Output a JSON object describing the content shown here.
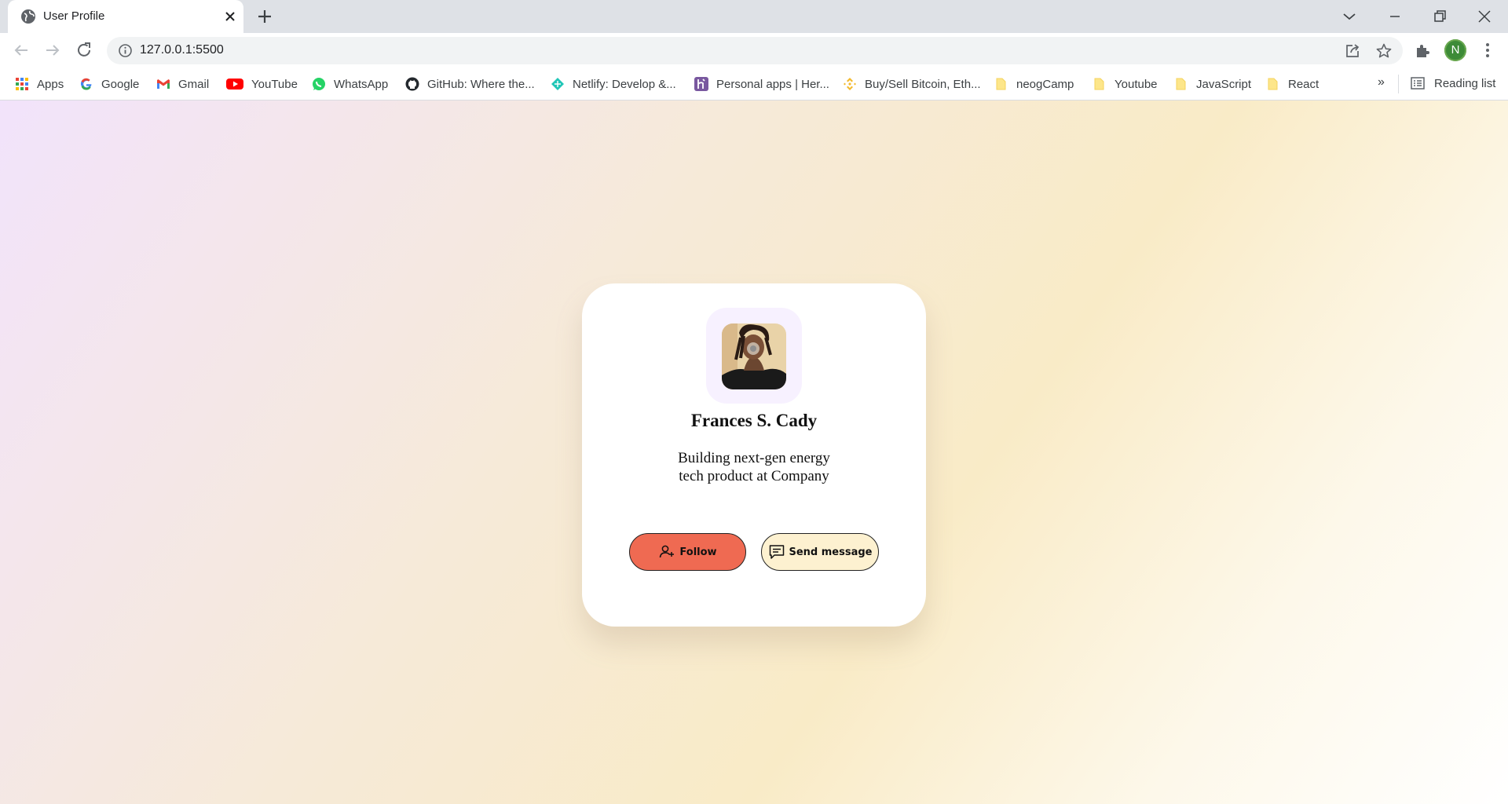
{
  "browser": {
    "tab": {
      "title": "User Profile"
    },
    "omnibox": {
      "url": "127.0.0.1:5500"
    },
    "profile_initial": "N",
    "bookmarks": [
      {
        "label": "Apps",
        "icon": "apps-grid-icon"
      },
      {
        "label": "Google",
        "icon": "google-icon"
      },
      {
        "label": "Gmail",
        "icon": "gmail-icon"
      },
      {
        "label": "YouTube",
        "icon": "youtube-icon"
      },
      {
        "label": "WhatsApp",
        "icon": "whatsapp-icon"
      },
      {
        "label": "GitHub: Where the...",
        "icon": "github-icon"
      },
      {
        "label": "Netlify: Develop &...",
        "icon": "netlify-icon"
      },
      {
        "label": "Personal apps | Her...",
        "icon": "heroku-icon"
      },
      {
        "label": "Buy/Sell Bitcoin, Eth...",
        "icon": "binance-icon"
      },
      {
        "label": "neogCamp",
        "icon": "folder-icon"
      },
      {
        "label": "Youtube",
        "icon": "folder-icon"
      },
      {
        "label": "JavaScript",
        "icon": "folder-icon"
      },
      {
        "label": "React",
        "icon": "folder-icon"
      }
    ],
    "overflow_label": "»",
    "reading_list_label": "Reading list"
  },
  "profile": {
    "name": "Frances S. Cady",
    "bio_line1": "Building next-gen energy",
    "bio_line2": "tech product at Company",
    "follow_label": "Follow",
    "message_label": "Send message",
    "colors": {
      "follow_bg": "#ef6a52",
      "message_bg": "#fdf1d0",
      "photo_frame_bg": "#f7f1ff"
    }
  }
}
